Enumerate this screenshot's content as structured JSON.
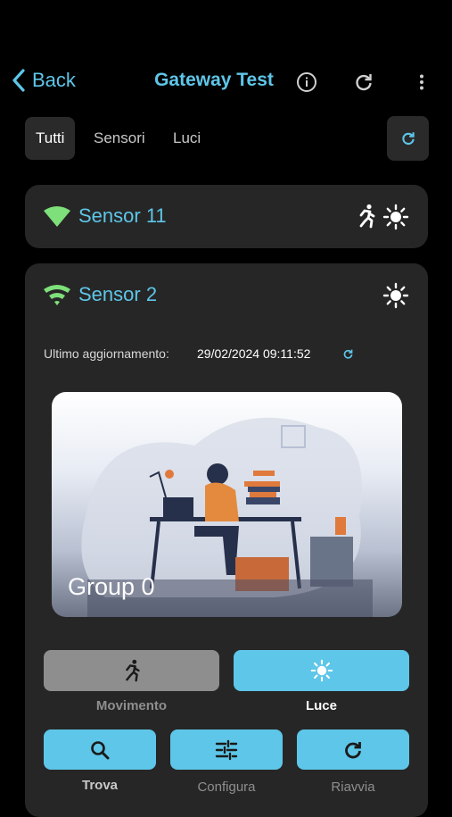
{
  "header": {
    "back_label": "Back",
    "title": "Gateway Test",
    "icons": [
      "info-icon",
      "refresh-icon",
      "more-vert-icon"
    ]
  },
  "tabs": {
    "items": [
      "Tutti",
      "Sensori",
      "Luci"
    ],
    "active": "Tutti"
  },
  "sensors": [
    {
      "name": "Sensor 11",
      "icons": [
        "motion-icon",
        "light-icon"
      ]
    },
    {
      "name": "Sensor 2",
      "icons": [
        "light-icon"
      ]
    }
  ],
  "detail": {
    "update_label": "Ultimo aggiornamento:",
    "update_value": "29/02/2024 09:11:52",
    "group_name": "Group 0",
    "modes": [
      {
        "label": "Movimento",
        "selected": false
      },
      {
        "label": "Luce",
        "selected": true
      }
    ],
    "actions": [
      "Trova",
      "Configura",
      "Riavvia"
    ]
  },
  "colors": {
    "accent": "#5ec6e8",
    "wifi": "#7ee07a",
    "card": "#262626",
    "background": "#000000",
    "inactive_button": "#8e8e8e"
  }
}
